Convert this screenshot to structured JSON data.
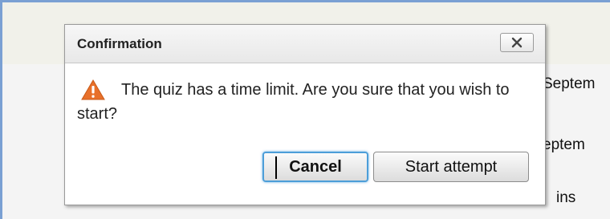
{
  "background": {
    "fragments": [
      "Septem",
      "eptem",
      "ins"
    ]
  },
  "dialog": {
    "title": "Confirmation",
    "close_symbol": "×",
    "message": "The quiz has a time limit. Are you sure that you wish to start?",
    "icon": "warning-triangle-icon",
    "buttons": {
      "cancel": "Cancel",
      "start": "Start attempt"
    }
  },
  "colors": {
    "warning": "#e8702a",
    "focus_ring": "#4c9ed9",
    "page_border": "#7aa0d3"
  }
}
